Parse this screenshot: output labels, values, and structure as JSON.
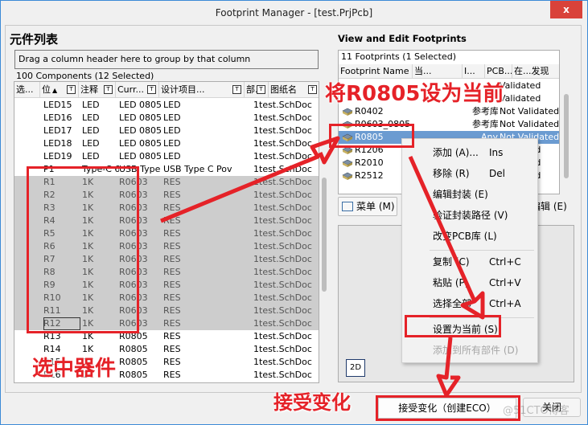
{
  "window": {
    "title": "Footprint Manager - [test.PrjPcb]",
    "close_glyph": "x"
  },
  "left_panel": {
    "title": "元件列表",
    "group_hint": "Drag a column header here to group by that column",
    "count_text": "100 Components (12 Selected)",
    "columns": [
      {
        "label": "选...",
        "sort": "",
        "filter": false
      },
      {
        "label": "位",
        "sort": "▲",
        "filter": true
      },
      {
        "label": "注释",
        "sort": "",
        "filter": true
      },
      {
        "label": "Curr...",
        "sort": "",
        "filter": true
      },
      {
        "label": "设计项目...",
        "sort": "",
        "filter": true
      },
      {
        "label": "部..",
        "sort": "",
        "filter": true
      },
      {
        "label": "图纸名",
        "sort": "",
        "filter": true
      }
    ],
    "filter_glyph": "T",
    "rows": [
      {
        "designator": "LED15",
        "comment": "LED",
        "current": "LED 0805",
        "design_item": "LED",
        "part": "1",
        "sheet": "test.SchDoc",
        "selected": false
      },
      {
        "designator": "LED16",
        "comment": "LED",
        "current": "LED 0805",
        "design_item": "LED",
        "part": "1",
        "sheet": "test.SchDoc",
        "selected": false
      },
      {
        "designator": "LED17",
        "comment": "LED",
        "current": "LED 0805",
        "design_item": "LED",
        "part": "1",
        "sheet": "test.SchDoc",
        "selected": false
      },
      {
        "designator": "LED18",
        "comment": "LED",
        "current": "LED 0805",
        "design_item": "LED",
        "part": "1",
        "sheet": "test.SchDoc",
        "selected": false
      },
      {
        "designator": "LED19",
        "comment": "LED",
        "current": "LED 0805",
        "design_item": "LED",
        "part": "1",
        "sheet": "test.SchDoc",
        "selected": false
      },
      {
        "designator": "P1",
        "comment": "Type-C 6",
        "current": "USB Type C",
        "design_item": "USB Type C Pov",
        "part": "1",
        "sheet": "test.SchDoc",
        "selected": false
      },
      {
        "designator": "R1",
        "comment": "1K",
        "current": "R0603",
        "design_item": "RES",
        "part": "1",
        "sheet": "test.SchDoc",
        "selected": true
      },
      {
        "designator": "R2",
        "comment": "1K",
        "current": "R0603",
        "design_item": "RES",
        "part": "1",
        "sheet": "test.SchDoc",
        "selected": true
      },
      {
        "designator": "R3",
        "comment": "1K",
        "current": "R0603",
        "design_item": "RES",
        "part": "1",
        "sheet": "test.SchDoc",
        "selected": true
      },
      {
        "designator": "R4",
        "comment": "1K",
        "current": "R0603",
        "design_item": "RES",
        "part": "1",
        "sheet": "test.SchDoc",
        "selected": true
      },
      {
        "designator": "R5",
        "comment": "1K",
        "current": "R0603",
        "design_item": "RES",
        "part": "1",
        "sheet": "test.SchDoc",
        "selected": true
      },
      {
        "designator": "R6",
        "comment": "1K",
        "current": "R0603",
        "design_item": "RES",
        "part": "1",
        "sheet": "test.SchDoc",
        "selected": true
      },
      {
        "designator": "R7",
        "comment": "1K",
        "current": "R0603",
        "design_item": "RES",
        "part": "1",
        "sheet": "test.SchDoc",
        "selected": true
      },
      {
        "designator": "R8",
        "comment": "1K",
        "current": "R0603",
        "design_item": "RES",
        "part": "1",
        "sheet": "test.SchDoc",
        "selected": true
      },
      {
        "designator": "R9",
        "comment": "1K",
        "current": "R0603",
        "design_item": "RES",
        "part": "1",
        "sheet": "test.SchDoc",
        "selected": true
      },
      {
        "designator": "R10",
        "comment": "1K",
        "current": "R0603",
        "design_item": "RES",
        "part": "1",
        "sheet": "test.SchDoc",
        "selected": true
      },
      {
        "designator": "R11",
        "comment": "1K",
        "current": "R0603",
        "design_item": "RES",
        "part": "1",
        "sheet": "test.SchDoc",
        "selected": true
      },
      {
        "designator": "R12",
        "comment": "1K",
        "current": "R0603",
        "design_item": "RES",
        "part": "1",
        "sheet": "test.SchDoc",
        "selected": true,
        "focused": true
      },
      {
        "designator": "R13",
        "comment": "1K",
        "current": "R0805",
        "design_item": "RES",
        "part": "1",
        "sheet": "test.SchDoc",
        "selected": false
      },
      {
        "designator": "R14",
        "comment": "1K",
        "current": "R0805",
        "design_item": "RES",
        "part": "1",
        "sheet": "test.SchDoc",
        "selected": false
      },
      {
        "designator": "R15",
        "comment": "1K",
        "current": "R0805",
        "design_item": "RES",
        "part": "1",
        "sheet": "test.SchDoc",
        "selected": false
      },
      {
        "designator": "R16",
        "comment": "1K",
        "current": "R0805",
        "design_item": "RES",
        "part": "1",
        "sheet": "test.SchDoc",
        "selected": false
      }
    ]
  },
  "right_panel": {
    "title": "View and Edit Footprints",
    "count_text": "11 Footprints (1 Selected)",
    "columns": [
      "Footprint Name",
      "当...",
      "I...",
      "PCB...",
      "在...发现"
    ],
    "rows": [
      {
        "name": "",
        "library": "",
        "status": "Validated",
        "selected": false
      },
      {
        "name": "",
        "library": "",
        "status": "Validated",
        "selected": false
      },
      {
        "name": "R0402",
        "library": "参考库",
        "status": "Not Validated",
        "selected": false
      },
      {
        "name": "R0603_0805",
        "library": "参考库",
        "status": "Not Validated",
        "selected": false
      },
      {
        "name": "R0805",
        "library": "Any",
        "status": "Not Validated",
        "selected": true
      },
      {
        "name": "R1206",
        "library": "",
        "status": "Validated",
        "selected": false
      },
      {
        "name": "R2010",
        "library": "",
        "status": "Validated",
        "selected": false
      },
      {
        "name": "R2512",
        "library": "",
        "status": "Validated",
        "selected": false
      }
    ],
    "menu_button": "菜单 (M)",
    "edit_button": "编辑 (E)",
    "view_2d_button": "2D"
  },
  "context_menu": {
    "items": [
      {
        "label": "添加 (A)...",
        "shortcut": "Ins",
        "disabled": false
      },
      {
        "label": "移除 (R)",
        "shortcut": "Del",
        "disabled": false
      },
      {
        "label": "编辑封装 (E)",
        "shortcut": "",
        "disabled": false
      },
      {
        "label": "验证封装路径 (V)",
        "shortcut": "",
        "disabled": false
      },
      {
        "label": "改变PCB库 (L)",
        "shortcut": "",
        "disabled": false
      },
      {
        "separator": true
      },
      {
        "label": "复制 (C)",
        "shortcut": "Ctrl+C",
        "disabled": false
      },
      {
        "label": "粘贴 (P)",
        "shortcut": "Ctrl+V",
        "disabled": false
      },
      {
        "label": "选择全部",
        "shortcut": "Ctrl+A",
        "disabled": false
      },
      {
        "separator": true
      },
      {
        "label": "设置为当前 (S)",
        "shortcut": "",
        "disabled": false
      },
      {
        "label": "添加到所有部件 (D)",
        "shortcut": "",
        "disabled": true
      }
    ]
  },
  "footer": {
    "accept_button": "接受变化（创建ECO）",
    "close_button": "关闭",
    "watermark": "@51CTO博客"
  },
  "annotations": {
    "select_components": "选中器件",
    "set_current": "将R0805设为当前",
    "accept_changes": "接受变化",
    "color": "#e52228"
  }
}
